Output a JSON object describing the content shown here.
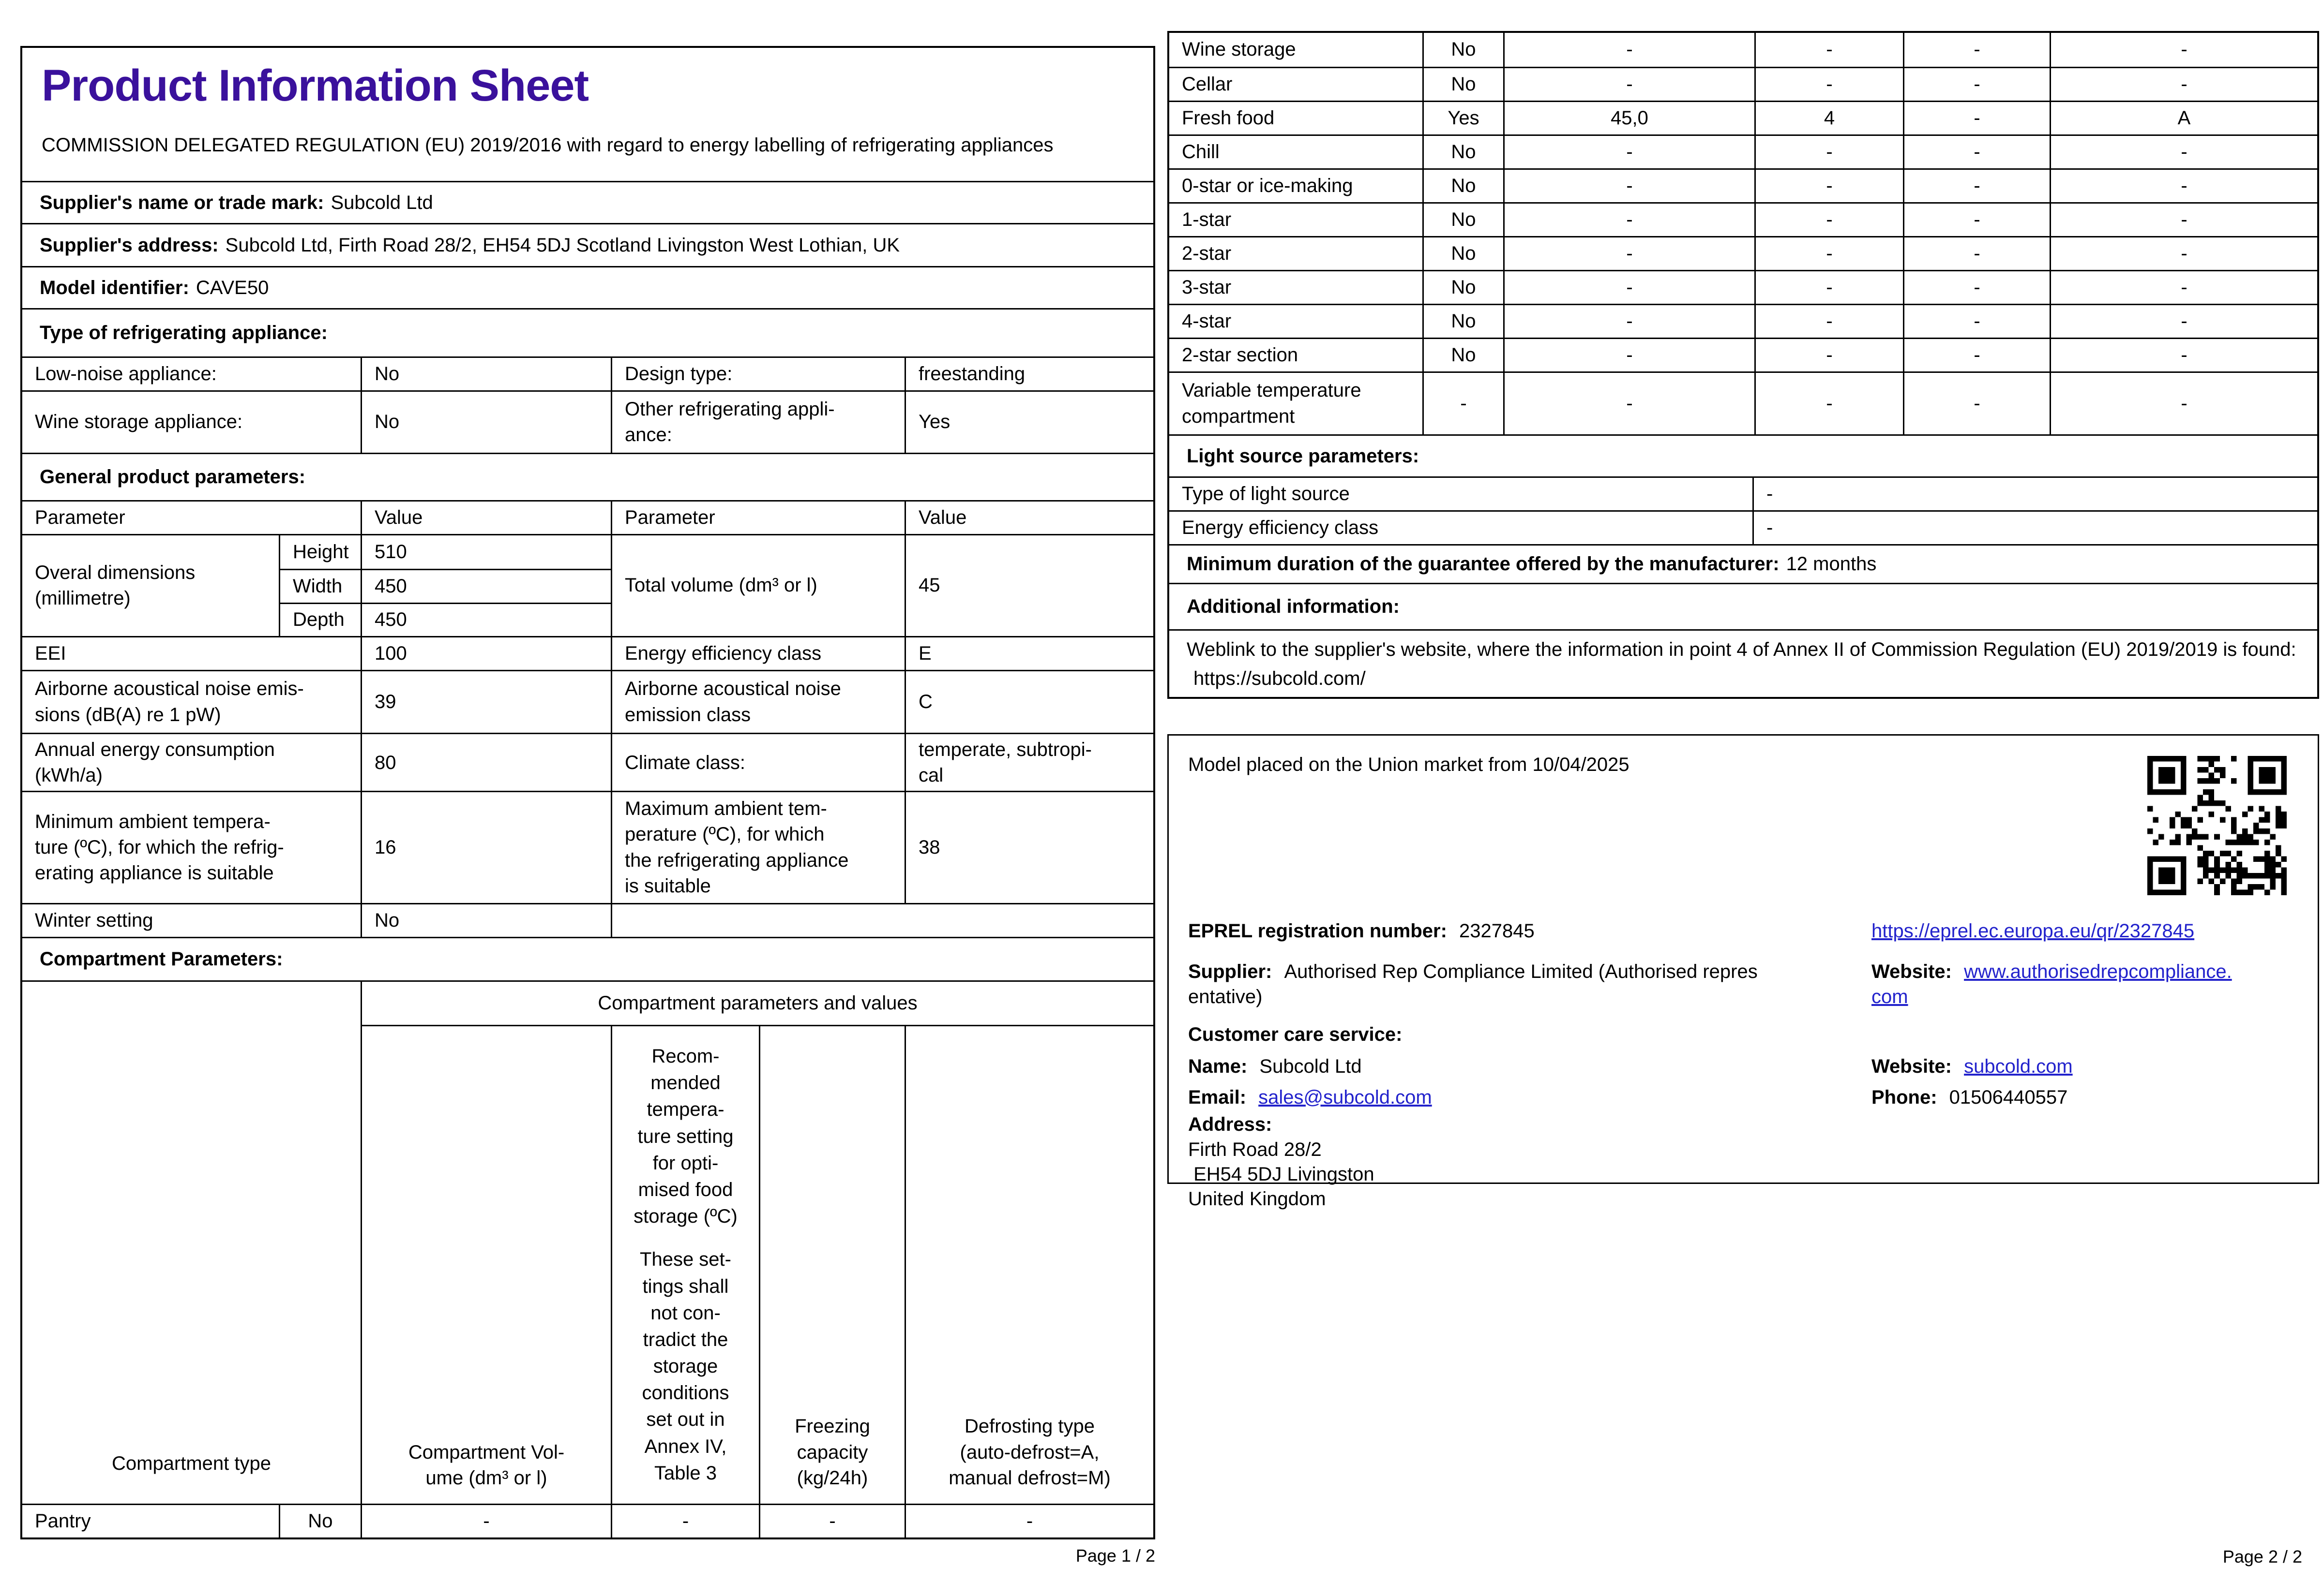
{
  "colors": {
    "title_accent": "#3A119C",
    "link_blue": "#2222CC",
    "border_black": "#000000"
  },
  "page1": {
    "title": "Product Information Sheet",
    "regulation": "COMMISSION DELEGATED REGULATION (EU) 2019/2016 with regard to energy labelling of refrigerating appliances",
    "supplier_name": {
      "label": "Supplier's name or trade mark:",
      "value": "Subcold Ltd"
    },
    "supplier_address": {
      "label": "Supplier's address:",
      "value": "Subcold Ltd, Firth Road 28/2, EH54 5DJ Scotland Livingston West Lothian, UK"
    },
    "model_identifier": {
      "label": "Model identifier:",
      "value": "CAVE50"
    },
    "type_section_header": "Type of refrigerating appliance:",
    "type_rows": [
      {
        "p1": "Low-noise appliance:",
        "v1": "No",
        "p2": "Design type:",
        "v2": "freestanding"
      },
      {
        "p1": "Wine storage appliance:",
        "v1": "No",
        "p2": "Other refrigerating appli-\nance:",
        "v2": "Yes"
      }
    ],
    "general_section_header": "General product parameters:",
    "param_header": {
      "c1": "Parameter",
      "c2": "Value",
      "c3": "Parameter",
      "c4": "Value"
    },
    "dimensions": {
      "label": "Overal dimensions\n(millimetre)",
      "rows": [
        {
          "k": "Height",
          "v": "510"
        },
        {
          "k": "Width",
          "v": "450"
        },
        {
          "k": "Depth",
          "v": "450"
        }
      ],
      "p2": "Total volume (dm³ or l)",
      "v2": "45"
    },
    "param_rows": [
      {
        "p1": "EEI",
        "v1": "100",
        "p2": "Energy efficiency class",
        "v2": "E"
      },
      {
        "p1": "Airborne acoustical noise emis-\nsions (dB(A) re 1 pW)",
        "v1": "39",
        "p2": "Airborne acoustical noise\nemission class",
        "v2": "C"
      },
      {
        "p1": "Annual energy consumption\n(kWh/a)",
        "v1": "80",
        "p2": "Climate class:",
        "v2": "temperate, subtropi-\ncal"
      },
      {
        "p1": "Minimum ambient tempera-\nture (ºC), for which the refrig-\nerating appliance is suitable",
        "v1": "16",
        "p2": "Maximum ambient tem-\nperature (ºC), for which\nthe refrigerating appliance\nis suitable",
        "v2": "38"
      }
    ],
    "winter_row": {
      "p1": "Winter setting",
      "v1": "No"
    },
    "compartment_section_header": "Compartment Parameters:",
    "compartment_table": {
      "span_header": "Compartment parameters and values",
      "col_type": "Compartment type",
      "col_volume": "Compartment Vol-\nume (dm³ or l)",
      "col_temp_a": "Recom-\nmended\ntempera-\nture setting\nfor opti-\nmised food\nstorage (ºC)",
      "col_temp_b": "These set-\ntings shall\nnot con-\ntradict the\nstorage\nconditions\nset out in\nAnnex IV,\nTable 3",
      "col_freezing": "Freezing\ncapacity\n(kg/24h)",
      "col_defrost": "Defrosting type\n(auto-defrost=A,\nmanual defrost=M)",
      "pantry": {
        "name": "Pantry",
        "answer": "No",
        "volume": "-",
        "temp": "-",
        "freezing": "-",
        "defrost": "-"
      }
    },
    "footer": "Page 1 / 2"
  },
  "page2": {
    "comp_rows": [
      {
        "name": "Wine storage",
        "answer": "No",
        "volume": "-",
        "temp": "-",
        "freezing": "-",
        "defrost": "-"
      },
      {
        "name": "Cellar",
        "answer": "No",
        "volume": "-",
        "temp": "-",
        "freezing": "-",
        "defrost": "-"
      },
      {
        "name": "Fresh food",
        "answer": "Yes",
        "volume": "45,0",
        "temp": "4",
        "freezing": "-",
        "defrost": "A"
      },
      {
        "name": "Chill",
        "answer": "No",
        "volume": "-",
        "temp": "-",
        "freezing": "-",
        "defrost": "-"
      },
      {
        "name": "0-star or ice-making",
        "answer": "No",
        "volume": "-",
        "temp": "-",
        "freezing": "-",
        "defrost": "-"
      },
      {
        "name": "1-star",
        "answer": "No",
        "volume": "-",
        "temp": "-",
        "freezing": "-",
        "defrost": "-"
      },
      {
        "name": "2-star",
        "answer": "No",
        "volume": "-",
        "temp": "-",
        "freezing": "-",
        "defrost": "-"
      },
      {
        "name": "3-star",
        "answer": "No",
        "volume": "-",
        "temp": "-",
        "freezing": "-",
        "defrost": "-"
      },
      {
        "name": "4-star",
        "answer": "No",
        "volume": "-",
        "temp": "-",
        "freezing": "-",
        "defrost": "-"
      },
      {
        "name": "2-star section",
        "answer": "No",
        "volume": "-",
        "temp": "-",
        "freezing": "-",
        "defrost": "-"
      },
      {
        "name": "Variable temperature\ncompartment",
        "answer": "-",
        "volume": "-",
        "temp": "-",
        "freezing": "-",
        "defrost": "-"
      }
    ],
    "light_section_header": "Light source parameters:",
    "light_rows": [
      {
        "label": "Type of light source",
        "value": "-"
      },
      {
        "label": "Energy efficiency class",
        "value": "-"
      }
    ],
    "guarantee": {
      "label": "Minimum duration of the guarantee offered by the manufacturer:",
      "value": "12 months"
    },
    "additional_section_header": "Additional information:",
    "weblink": {
      "text": "Weblink to the supplier's website, where the information in point 4 of Annex II of Commission Regulation (EU) 2019/2019 is found:",
      "url": "https://subcold.com/"
    },
    "eprel_box": {
      "market_text": "Model placed on the Union market from 10/04/2025",
      "eprel_label": "EPREL registration number:",
      "eprel_value": "2327845",
      "eprel_link": "https://eprel.ec.europa.eu/qr/2327845",
      "supplier_label": "Supplier:",
      "supplier_value": "Authorised Rep Compliance Limited (Authorised repres\nentative)",
      "website_label": "Website:",
      "website_value": "www.authorisedrepcompliance.\ncom",
      "care_header": "Customer care service:",
      "name_label": "Name:",
      "name_value": "Subcold Ltd",
      "website2_label": "Website:",
      "website2_value": "subcold.com",
      "email_label": "Email:",
      "email_value": "sales@subcold.com",
      "phone_label": "Phone:",
      "phone_value": "01506440557",
      "address_label": "Address:",
      "address_line1": "Firth Road 28/2",
      "address_line2": " EH54 5DJ Livingston",
      "address_line3": "United Kingdom"
    },
    "footer": "Page 2 / 2"
  }
}
